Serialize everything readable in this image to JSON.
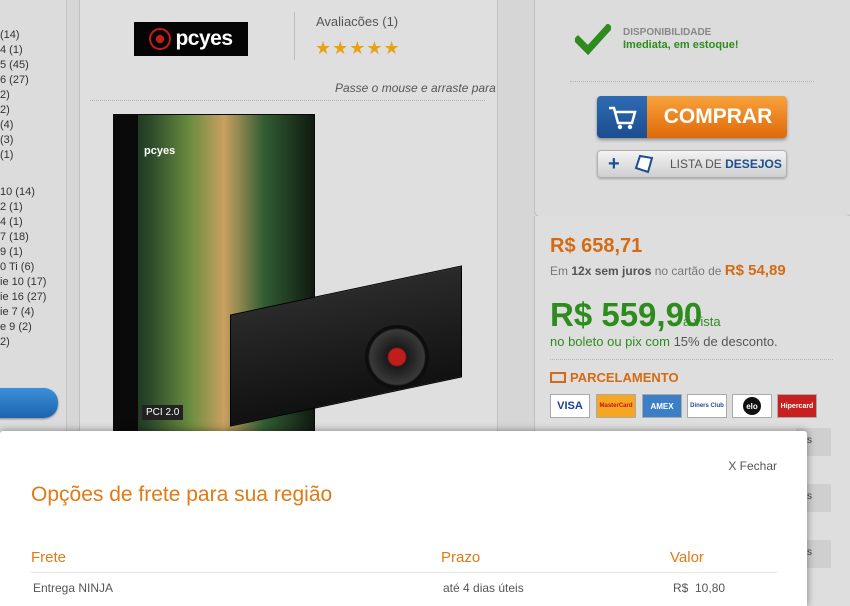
{
  "sidebar": {
    "items": [
      "(14)",
      "4 (1)",
      "5 (45)",
      "6 (27)",
      "2)",
      "2)",
      "(4)",
      "(3)",
      "(1)",
      "10 (14)",
      "2 (1)",
      "4 (1)",
      "7 (18)",
      "9 (1)",
      "0 Ti (6)",
      "ie 10 (17)",
      "ie 16 (27)",
      "ie 7 (4)",
      "e 9 (2)",
      "2)"
    ]
  },
  "product": {
    "brand_logo_text": "pcyes",
    "reviews_label": "Avaliacões (1)",
    "rating_stars": 5,
    "zoom_hint": "Passe o mouse e arraste para"
  },
  "availability": {
    "label": "DISPONIBILIDADE",
    "value": "Imediata, em estoque!"
  },
  "actions": {
    "buy_label": "COMPRAR",
    "wishlist_prefix": "LISTA DE ",
    "wishlist_strong": "DESEJOS"
  },
  "pricing": {
    "old_price": "R$ 658,71",
    "installments_prefix": "Em ",
    "installments_strong": "12x sem juros",
    "installments_suffix": " no cartão de ",
    "installment_value": "R$ 54,89",
    "cash_price": "R$ 559,90",
    "cash_suffix": "à vista",
    "discount_green": "no boleto ou pix com",
    "discount_rest": " 15% de desconto."
  },
  "payment": {
    "title": "PARCELAMENTO",
    "cards": [
      "VISA",
      "MasterCard",
      "AMEX",
      "Diners Club",
      "elo",
      "Hipercard"
    ]
  },
  "shipping_modal": {
    "close_label": "X Fechar",
    "title": "Opções de frete para sua região",
    "headers": {
      "frete": "Frete",
      "prazo": "Prazo",
      "valor": "Valor"
    },
    "rows": [
      {
        "frete": "Entrega NINJA",
        "prazo": "até 4 dias úteis",
        "valor": "R$  10,80"
      }
    ]
  },
  "colors": {
    "orange": "#e07a14",
    "green": "#2e8c1e",
    "blue": "#1d4f90"
  }
}
